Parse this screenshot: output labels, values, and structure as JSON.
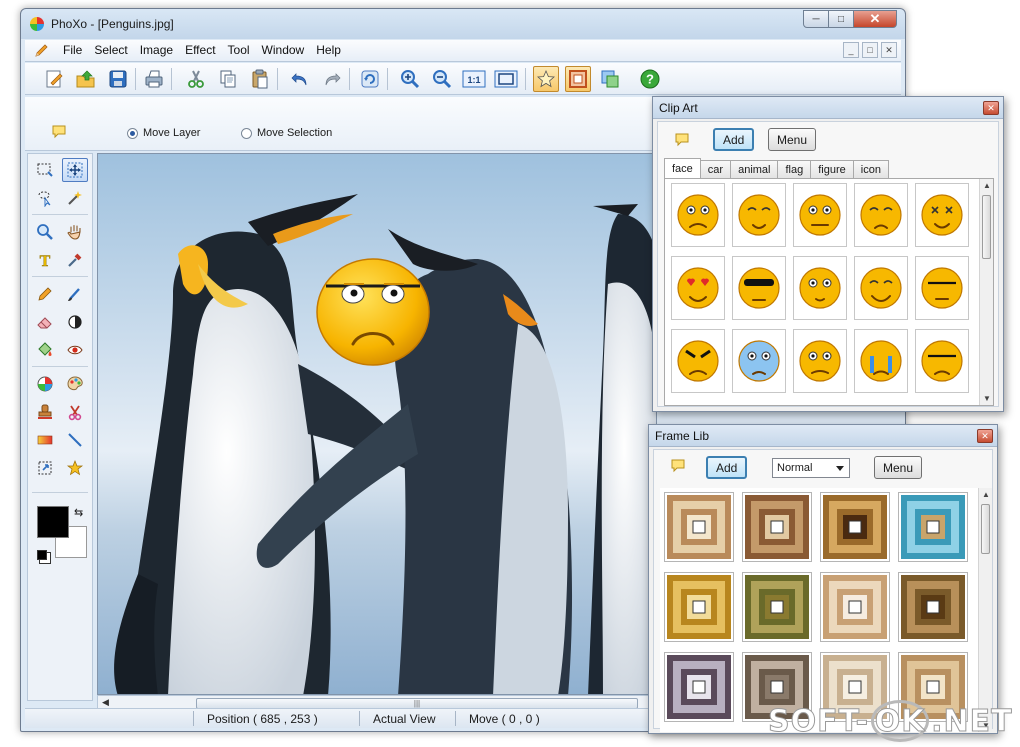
{
  "window": {
    "title": "PhoXo - [Penguins.jpg]",
    "controls": [
      "minimize",
      "maximize",
      "close"
    ]
  },
  "menu": {
    "items": [
      "File",
      "Select",
      "Image",
      "Effect",
      "Tool",
      "Window",
      "Help"
    ]
  },
  "toolbar": {
    "buttons": [
      {
        "icon": "new-icon"
      },
      {
        "icon": "open-icon"
      },
      {
        "icon": "save-icon"
      },
      {
        "icon": "print-icon"
      },
      {
        "icon": "cut-icon"
      },
      {
        "icon": "copy-icon"
      },
      {
        "icon": "paste-icon"
      },
      {
        "icon": "undo-icon"
      },
      {
        "icon": "redo-icon"
      },
      {
        "icon": "refresh-icon"
      },
      {
        "icon": "zoom-in-icon"
      },
      {
        "icon": "zoom-out-icon"
      },
      {
        "icon": "actual-size-icon",
        "label": "1:1"
      },
      {
        "icon": "fit-window-icon"
      },
      {
        "icon": "clip-art-icon",
        "active": true
      },
      {
        "icon": "frame-icon",
        "active": true
      },
      {
        "icon": "layers-icon"
      },
      {
        "icon": "help-icon"
      }
    ]
  },
  "options": {
    "move_layer": "Move Layer",
    "move_selection": "Move Selection",
    "selected": "Move Layer"
  },
  "canvas": {
    "image": "Penguins.jpg"
  },
  "status": {
    "position": "Position ( 685 , 253 )",
    "view": "Actual View",
    "move": "Move ( 0 , 0 )"
  },
  "clip_art": {
    "title": "Clip Art",
    "add": "Add",
    "menu": "Menu",
    "tabs": [
      "face",
      "car",
      "animal",
      "flag",
      "figure",
      "icon"
    ],
    "active_tab": "face"
  },
  "frame_lib": {
    "title": "Frame Lib",
    "add": "Add",
    "mode": "Normal",
    "menu": "Menu"
  },
  "watermark": {
    "left": "SOFT-",
    "middle": "OK",
    "right": ".NET"
  },
  "colors": {
    "foreground": "#000000",
    "background": "#ffffff",
    "accent": "#3c7fb1",
    "close": "#c5462b"
  }
}
